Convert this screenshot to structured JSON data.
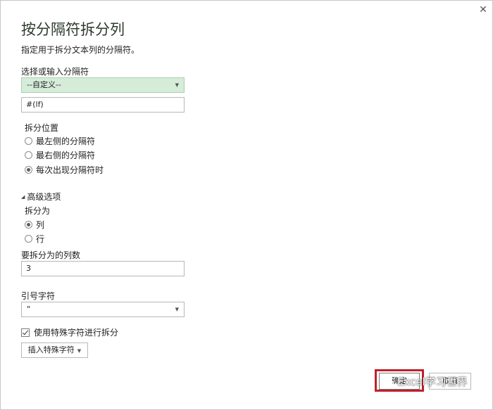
{
  "dialog": {
    "title": "按分隔符拆分列",
    "description": "指定用于拆分文本列的分隔符。",
    "close_glyph": "✕"
  },
  "delimiter": {
    "label": "选择或输入分隔符",
    "selected": "--自定义--",
    "custom_value": "#(lf)"
  },
  "split_at": {
    "label": "拆分位置",
    "options": [
      "最左侧的分隔符",
      "最右侧的分隔符",
      "每次出现分隔符时"
    ],
    "selected_index": 2
  },
  "advanced": {
    "header": "高级选项",
    "split_into_label": "拆分为",
    "split_into_options": [
      "列",
      "行"
    ],
    "split_into_selected_index": 0,
    "num_columns_label": "要拆分为的列数",
    "num_columns_value": "3",
    "quote_char_label": "引号字符",
    "quote_char_value": "\"",
    "special_chars_checkbox_label": "使用特殊字符进行拆分",
    "special_chars_checked": true,
    "insert_special_button": "插入特殊字符"
  },
  "footer": {
    "ok_label": "确定",
    "cancel_label": "取消"
  },
  "watermark": {
    "text": "Excel学习世界"
  },
  "colors": {
    "dropdown_highlight": "#d5ecd9",
    "ok_highlight_border": "#c0202a"
  },
  "icons": {
    "close": "close-icon",
    "dropdown": "chevron-down-icon",
    "expand": "triangle-expanded-icon",
    "watermark": "wechat-icon"
  }
}
